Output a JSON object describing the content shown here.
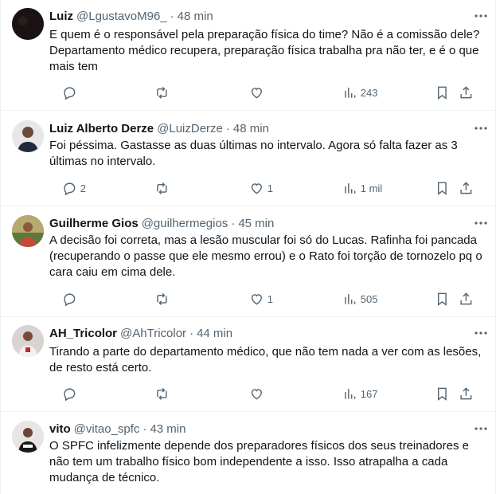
{
  "tweets": [
    {
      "name": "Luiz",
      "handle": "@LgustavoM96_",
      "time": "48 min",
      "text": "E quem é o responsável pela preparação física do time? Não é a comissão dele? Departamento médico recupera, preparação física trabalha pra não ter, e é o que mais tem",
      "replies": "",
      "reposts": "",
      "likes": "",
      "views": "243",
      "avatar_color": "#1b1313"
    },
    {
      "name": "Luiz Alberto Derze",
      "handle": "@LuizDerze",
      "time": "48 min",
      "text": "Foi péssima. Gastasse as duas últimas no intervalo. Agora só falta fazer as 3 últimas no intervalo.",
      "replies": "2",
      "reposts": "",
      "likes": "1",
      "views": "1 mil",
      "avatar_color": "#d7d7d7"
    },
    {
      "name": "Guilherme Gios",
      "handle": "@guilhermegios",
      "time": "45 min",
      "text": "A decisão foi correta, mas a lesão muscular foi só do Lucas. Rafinha foi pancada (recuperando o passe que ele mesmo errou) e o Rato foi torção de tornozelo pq o cara caiu em cima dele.",
      "replies": "",
      "reposts": "",
      "likes": "1",
      "views": "505",
      "avatar_color": "#9a8a55"
    },
    {
      "name": "AH_Tricolor",
      "handle": "@AhTricolor",
      "time": "44 min",
      "text": "Tirando a parte do departamento médico, que não tem nada a ver com as lesões, de resto está certo.",
      "replies": "",
      "reposts": "",
      "likes": "",
      "views": "167",
      "avatar_color": "#cfc7c5"
    },
    {
      "name": "vito",
      "handle": "@vitao_spfc",
      "time": "43 min",
      "text": "O SPFC infelizmente depende dos preparadores físicos dos seus treinadores e não tem um trabalho físico bom independente a isso. Isso atrapalha a cada mudança de técnico.",
      "replies": "",
      "reposts": "",
      "likes": "",
      "views": "",
      "avatar_color": "#e8e4e4"
    }
  ],
  "accent_color": "#0f1419",
  "muted_color": "#536471"
}
